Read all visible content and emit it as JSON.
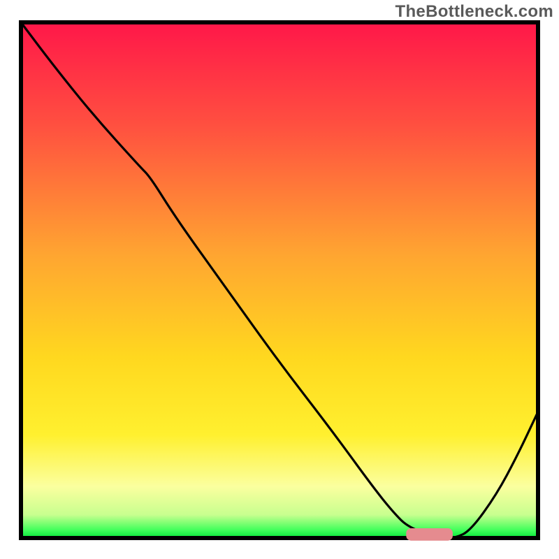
{
  "watermark": "TheBottleneck.com",
  "chart_data": {
    "type": "line",
    "title": "",
    "xlabel": "",
    "ylabel": "",
    "xlim": [
      0,
      1
    ],
    "ylim": [
      0,
      1
    ],
    "grid": false,
    "legend": false,
    "background": {
      "description": "Vertical gradient depicting bottleneck fit: red (top) → orange → yellow → pale yellow → bright green (bottom edge)",
      "stops": [
        {
          "offset": 0.0,
          "color": "#ff1749"
        },
        {
          "offset": 0.2,
          "color": "#ff5040"
        },
        {
          "offset": 0.45,
          "color": "#ffa531"
        },
        {
          "offset": 0.65,
          "color": "#ffd81f"
        },
        {
          "offset": 0.8,
          "color": "#fff02f"
        },
        {
          "offset": 0.9,
          "color": "#fbff9f"
        },
        {
          "offset": 0.955,
          "color": "#c8ff8f"
        },
        {
          "offset": 0.985,
          "color": "#3fff5a"
        },
        {
          "offset": 1.0,
          "color": "#05e63a"
        }
      ]
    },
    "series": [
      {
        "name": "bottleneck-curve",
        "description": "Black curve showing mismatch percentage; dips to zero around the optimal match zone then rises again",
        "x": [
          0.0,
          0.06,
          0.14,
          0.23,
          0.25,
          0.3,
          0.4,
          0.5,
          0.6,
          0.68,
          0.72,
          0.75,
          0.81,
          0.84,
          0.87,
          0.92,
          0.96,
          1.0
        ],
        "y": [
          1.0,
          0.92,
          0.82,
          0.72,
          0.7,
          0.62,
          0.48,
          0.34,
          0.21,
          0.1,
          0.05,
          0.02,
          0.0,
          0.0,
          0.015,
          0.085,
          0.16,
          0.245
        ]
      }
    ],
    "marker": {
      "description": "Rounded pink bar marking the minimum / optimal zone on the x-axis",
      "x_start": 0.745,
      "x_end": 0.835,
      "y": 0.007,
      "color": "#e58b8f",
      "thickness": 0.024
    },
    "border": {
      "color": "#000000",
      "width": 6
    }
  }
}
